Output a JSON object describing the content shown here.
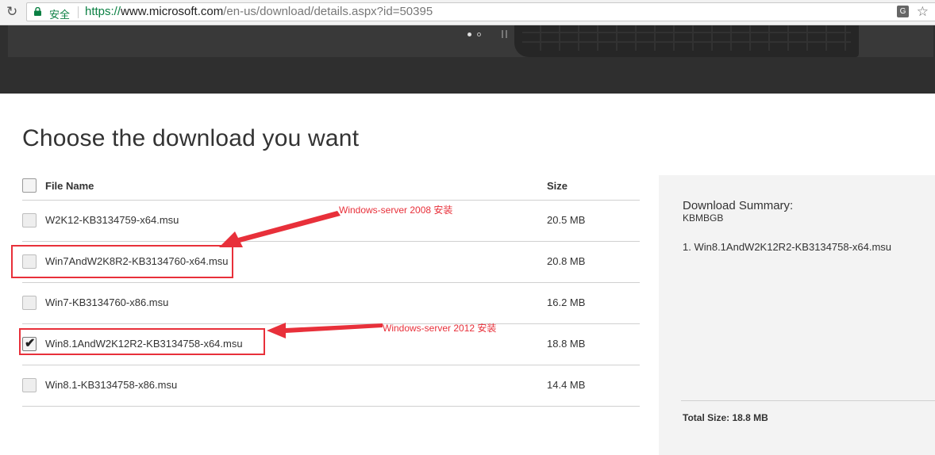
{
  "browser": {
    "secure_label": "安全",
    "url_scheme": "https://",
    "url_host": "www.microsoft.com",
    "url_path": "/en-us/download/details.aspx?id=50395",
    "colors": {
      "secure": "#0b8043"
    }
  },
  "carousel": {
    "active_dot": 0,
    "dot_count": 2
  },
  "main": {
    "title": "Choose the download you want",
    "columns": {
      "file_name": "File Name",
      "size": "Size"
    },
    "files": [
      {
        "name": "W2K12-KB3134759-x64.msu",
        "size": "20.5 MB",
        "checked": false
      },
      {
        "name": "Win7AndW2K8R2-KB3134760-x64.msu",
        "size": "20.8 MB",
        "checked": false
      },
      {
        "name": "Win7-KB3134760-x86.msu",
        "size": "16.2 MB",
        "checked": false
      },
      {
        "name": "Win8.1AndW2K12R2-KB3134758-x64.msu",
        "size": "18.8 MB",
        "checked": true
      },
      {
        "name": "Win8.1-KB3134758-x86.msu",
        "size": "14.4 MB",
        "checked": false
      }
    ]
  },
  "summary": {
    "title": "Download Summary:",
    "code": "KBMBGB",
    "items": [
      "1. Win8.1AndW2K12R2-KB3134758-x64.msu"
    ],
    "total": "Total Size: 18.8 MB"
  },
  "annotations": {
    "note_2008": "Windows-server 2008 安装",
    "note_2012": "Windows-server 2012 安装",
    "color": "#e8303a"
  }
}
